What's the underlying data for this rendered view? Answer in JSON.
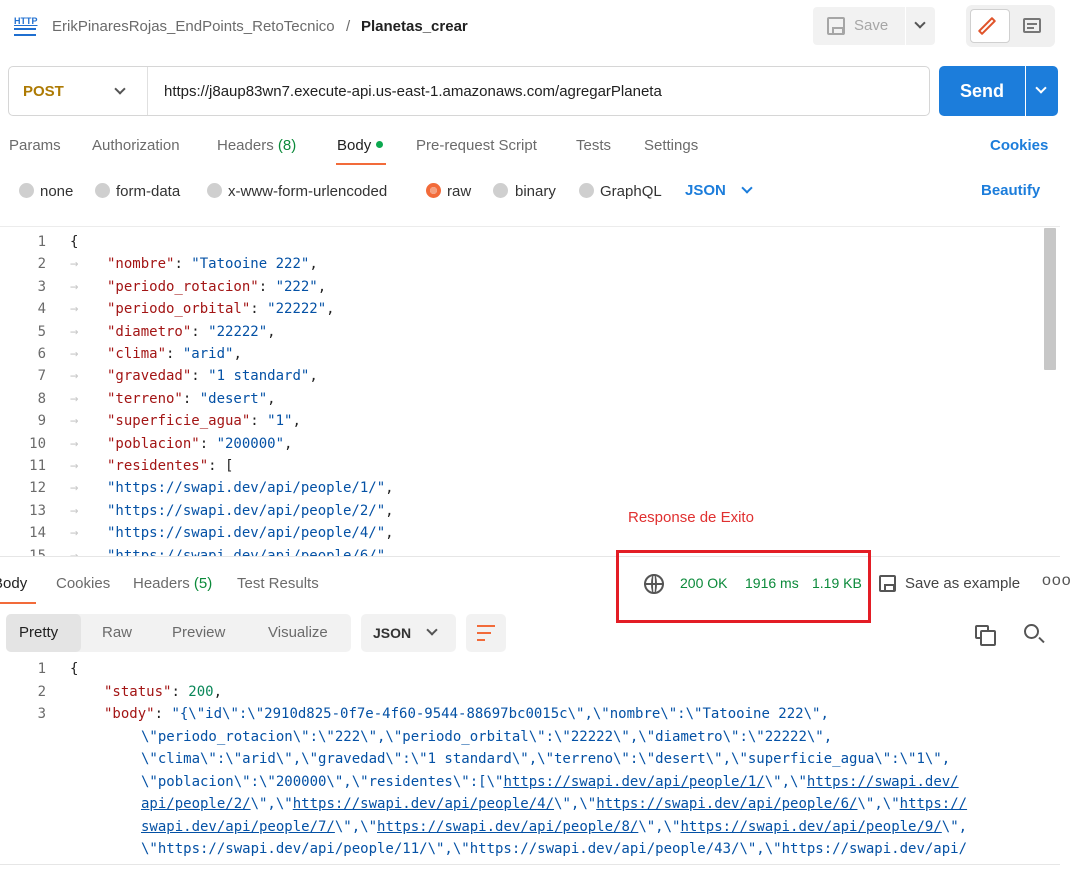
{
  "header": {
    "http_badge": "HTTP",
    "collection": "ErikPinaresRojas_EndPoints_RetoTecnico",
    "separator": "/",
    "request_name": "Planetas_crear",
    "save_label": "Save"
  },
  "request": {
    "method": "POST",
    "url": "https://j8aup83wn7.execute-api.us-east-1.amazonaws.com/agregarPlaneta",
    "send_label": "Send"
  },
  "request_tabs": {
    "params": "Params",
    "authorization": "Authorization",
    "headers": "Headers",
    "headers_count": "(8)",
    "body": "Body",
    "prerequest": "Pre-request Script",
    "tests": "Tests",
    "settings": "Settings",
    "cookies": "Cookies"
  },
  "body_types": {
    "none": "none",
    "form_data": "form-data",
    "urlencoded": "x-www-form-urlencoded",
    "raw": "raw",
    "binary": "binary",
    "graphql": "GraphQL",
    "format": "JSON",
    "beautify": "Beautify",
    "selected": "raw"
  },
  "request_body_lines": [
    {
      "n": "1",
      "indent": false,
      "t": "{"
    },
    {
      "n": "2",
      "indent": true,
      "key": "\"nombre\"",
      "sep": ": ",
      "val": "\"Tatooine 222\"",
      "end": ","
    },
    {
      "n": "3",
      "indent": true,
      "key": "\"periodo_rotacion\"",
      "sep": ": ",
      "val": "\"222\"",
      "end": ","
    },
    {
      "n": "4",
      "indent": true,
      "key": "\"periodo_orbital\"",
      "sep": ": ",
      "val": "\"22222\"",
      "end": ","
    },
    {
      "n": "5",
      "indent": true,
      "key": "\"diametro\"",
      "sep": ": ",
      "val": "\"22222\"",
      "end": ","
    },
    {
      "n": "6",
      "indent": true,
      "key": "\"clima\"",
      "sep": ": ",
      "val": "\"arid\"",
      "end": ","
    },
    {
      "n": "7",
      "indent": true,
      "key": "\"gravedad\"",
      "sep": ": ",
      "val": "\"1 standard\"",
      "end": ","
    },
    {
      "n": "8",
      "indent": true,
      "key": "\"terreno\"",
      "sep": ": ",
      "val": "\"desert\"",
      "end": ","
    },
    {
      "n": "9",
      "indent": true,
      "key": "\"superficie_agua\"",
      "sep": ": ",
      "val": "\"1\"",
      "end": ","
    },
    {
      "n": "10",
      "indent": true,
      "key": "\"poblacion\"",
      "sep": ": ",
      "val": "\"200000\"",
      "end": ","
    },
    {
      "n": "11",
      "indent": true,
      "key": "\"residentes\"",
      "sep": ": ",
      "val": "",
      "end": "["
    },
    {
      "n": "12",
      "indent": true,
      "key": "",
      "sep": "",
      "val": "\"https://swapi.dev/api/people/1/\"",
      "end": ","
    },
    {
      "n": "13",
      "indent": true,
      "key": "",
      "sep": "",
      "val": "\"https://swapi.dev/api/people/2/\"",
      "end": ","
    },
    {
      "n": "14",
      "indent": true,
      "key": "",
      "sep": "",
      "val": "\"https://swapi.dev/api/people/4/\"",
      "end": ","
    },
    {
      "n": "15",
      "indent": true,
      "key": "",
      "sep": "",
      "val": "\"https://swapi.dev/api/people/6/\"",
      "end": ","
    }
  ],
  "annotation": "Response de Exito",
  "response_tabs": {
    "body": "Body",
    "cookies": "Cookies",
    "headers": "Headers",
    "headers_count": "(5)",
    "test_results": "Test Results"
  },
  "response_status": {
    "status": "200 OK",
    "time": "1916 ms",
    "size": "1.19 KB",
    "save_example": "Save as example",
    "more": "ooo"
  },
  "response_view": {
    "pretty": "Pretty",
    "raw": "Raw",
    "preview": "Preview",
    "visualize": "Visualize",
    "format": "JSON"
  },
  "response_lines": [
    {
      "n": "1",
      "t": "{"
    },
    {
      "n": "2",
      "key": "\"status\"",
      "sep": ": ",
      "num": "200",
      "end": ","
    },
    {
      "n": "3",
      "key": "\"body\"",
      "sep": ": ",
      "val": "\"{\\\"id\\\":\\\"2910d825-0f7e-4f60-9544-88697bc0015c\\\",\\\"nombre\\\":\\\"Tatooine 222\\\","
    },
    {
      "n": "",
      "cont": "\\\"periodo_rotacion\\\":\\\"222\\\",\\\"periodo_orbital\\\":\\\"22222\\\",\\\"diametro\\\":\\\"22222\\\","
    },
    {
      "n": "",
      "cont": "\\\"clima\\\":\\\"arid\\\",\\\"gravedad\\\":\\\"1 standard\\\",\\\"terreno\\\":\\\"desert\\\",\\\"superficie_agua\\\":\\\"1\\\","
    },
    {
      "n": "",
      "cont": "\\\"poblacion\\\":\\\"200000\\\",\\\"residentes\\\":[\\\"",
      "link": "https://swapi.dev/api/people/1/",
      "after": "\\\",\\\"",
      "link2": "https://swapi.dev/"
    },
    {
      "n": "",
      "link": "api/people/2/",
      "after": "\\\",\\\"",
      "link2": "https://swapi.dev/api/people/4/",
      "after2": "\\\",\\\"",
      "link3": "https://swapi.dev/api/people/6/",
      "after3": "\\\",\\\"",
      "link4": "https://"
    },
    {
      "n": "",
      "link": "swapi.dev/api/people/7/",
      "after": "\\\",\\\"",
      "link2": "https://swapi.dev/api/people/8/",
      "after2": "\\\",\\\"",
      "link3": "https://swapi.dev/api/people/9/",
      "after3": "\\\","
    },
    {
      "n": "",
      "cont": "\\\"https://swapi.dev/api/people/11/\\\",\\\"https://swapi.dev/api/people/43/\\\",\\\"https://swapi.dev/api/"
    }
  ]
}
